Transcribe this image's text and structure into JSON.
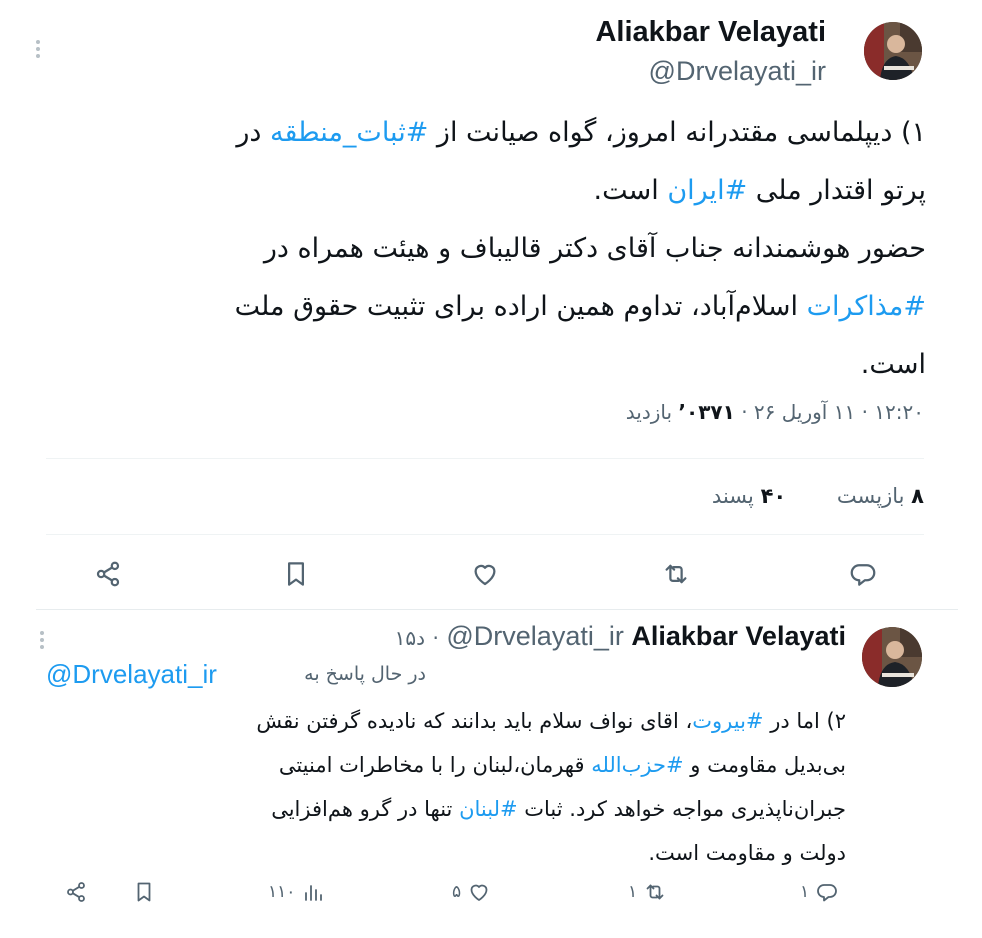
{
  "colors": {
    "accent": "#1d9bf0",
    "text": "#0f1419",
    "muted": "#536471",
    "divider": "#eff3f4"
  },
  "main_tweet": {
    "author_name": "Aliakbar Velayati",
    "author_handle": "@Drvelayati_ir",
    "text": {
      "p1_pre": "۱) دیپلماسی مقتدرانه امروز، گواه صیانت از ",
      "tag_stability": "#ثبات_منطقه",
      "p1_mid": " در\nپرتو اقتدار ملی ",
      "tag_iran": "#ایران",
      "p1_end": " است.\nحضور هوشمندانه جناب آقای دکتر قالیباف و هیئت  همراه در\n",
      "tag_negotiations": "#مذاکرات",
      "p2_end": " اسلام‌آباد، تداوم همین اراده برای تثبیت حقوق ملت\nاست."
    },
    "meta": {
      "time": "۱۲:۲۰",
      "date": "۱۱ آوریل ۲۶",
      "views_count": "۰۳۷۱’",
      "views_label": "بازدید",
      "sep": "·"
    },
    "stats": {
      "retweets_count": "۸",
      "retweets_label": "بازپست",
      "likes_count": "۴۰",
      "likes_label": "پسند"
    },
    "actions": [
      "reply-icon",
      "retweet-icon",
      "like-icon",
      "bookmark-icon",
      "share-icon"
    ]
  },
  "reply_tweet": {
    "author_name": "Aliakbar Velayati",
    "author_handle": "@Drvelayati_ir",
    "time": "۱۵د",
    "sep": "·",
    "replying_label": "در حال پاسخ به",
    "replying_handle": "@Drvelayati_ir",
    "text": {
      "l1_pre": "۲)  اما در ",
      "tag_beirut": "#بیروت",
      "l1_post": "، اقای نواف سلام باید بدانند که نادیده گرفتن نقش\nبی‌بدیل مقاومت و ",
      "tag_hezbollah": "#حزب‌الله",
      "l2_post": " قهرمان،لبنان را با مخاطرات امنیتی\nجبران‌ناپذیری مواجه خواهد کرد. ثبات ",
      "tag_lebanon": "#لبنان",
      "l3_post": "  تنها در گرو هم‌افزایی\nدولت و مقاومت است."
    },
    "counts": {
      "replies": "۱",
      "retweets": "۱",
      "likes": "۵",
      "views": "۱۱۰"
    }
  }
}
